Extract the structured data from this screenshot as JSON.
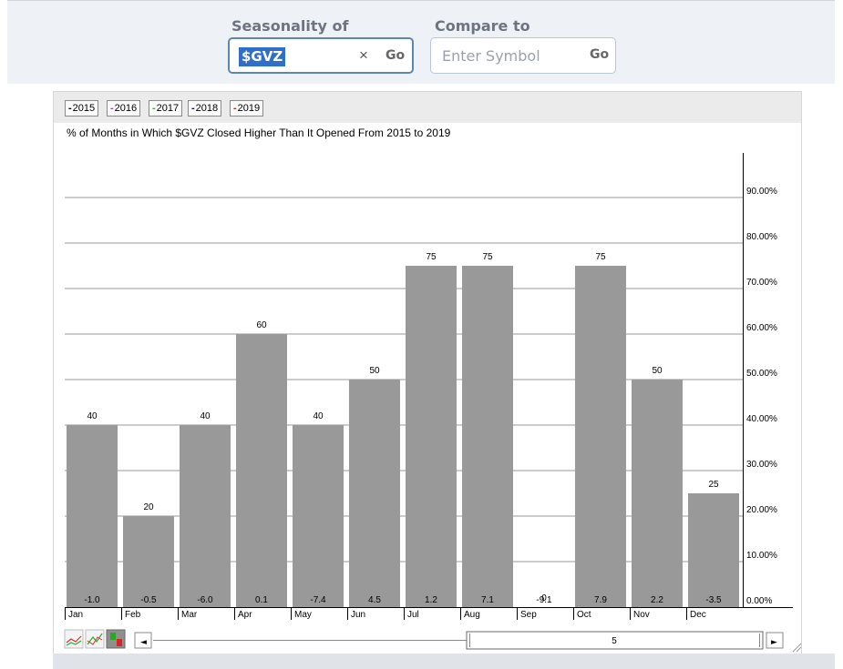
{
  "toolbar": {
    "seasonality_label": "Seasonality of",
    "symbol_value": "$GVZ",
    "clear_glyph": "×",
    "go_label": "Go",
    "compare_label": "Compare to",
    "compare_placeholder": "Enter Symbol",
    "compare_go_label": "Go"
  },
  "legend": [
    {
      "label": "2015",
      "color": "#000000"
    },
    {
      "label": "2016",
      "color": "#ff00ff"
    },
    {
      "label": "2017",
      "color": "#00cc00"
    },
    {
      "label": "2018",
      "color": "#0000cc"
    },
    {
      "label": "2019",
      "color": "#ff0000"
    }
  ],
  "chart_data": {
    "type": "bar",
    "title": "% of Months in Which $GVZ Closed Higher Than It Opened From 2015 to 2019",
    "categories": [
      "Jan",
      "Feb",
      "Mar",
      "Apr",
      "May",
      "Jun",
      "Jul",
      "Aug",
      "Sep",
      "Oct",
      "Nov",
      "Dec"
    ],
    "series": [
      {
        "values": [
          40,
          20,
          40,
          60,
          40,
          50,
          75,
          75,
          0,
          75,
          50,
          25
        ]
      },
      {
        "values": [
          -1.0,
          -0.5,
          -6.0,
          0.1,
          -7.4,
          4.5,
          1.2,
          7.1,
          -9.1,
          7.9,
          2.2,
          -3.5
        ]
      }
    ],
    "y_axis_position": "right",
    "yticks": [
      "0.00%",
      "10.00%",
      "20.00%",
      "30.00%",
      "40.00%",
      "50.00%",
      "60.00%",
      "70.00%",
      "80.00%",
      "90.00%"
    ],
    "ylim": [
      0,
      100
    ],
    "grid": true,
    "bar_color": "#999999"
  },
  "controls": {
    "scroll_left": "◄",
    "scroll_right": "►",
    "range_value": "5"
  }
}
